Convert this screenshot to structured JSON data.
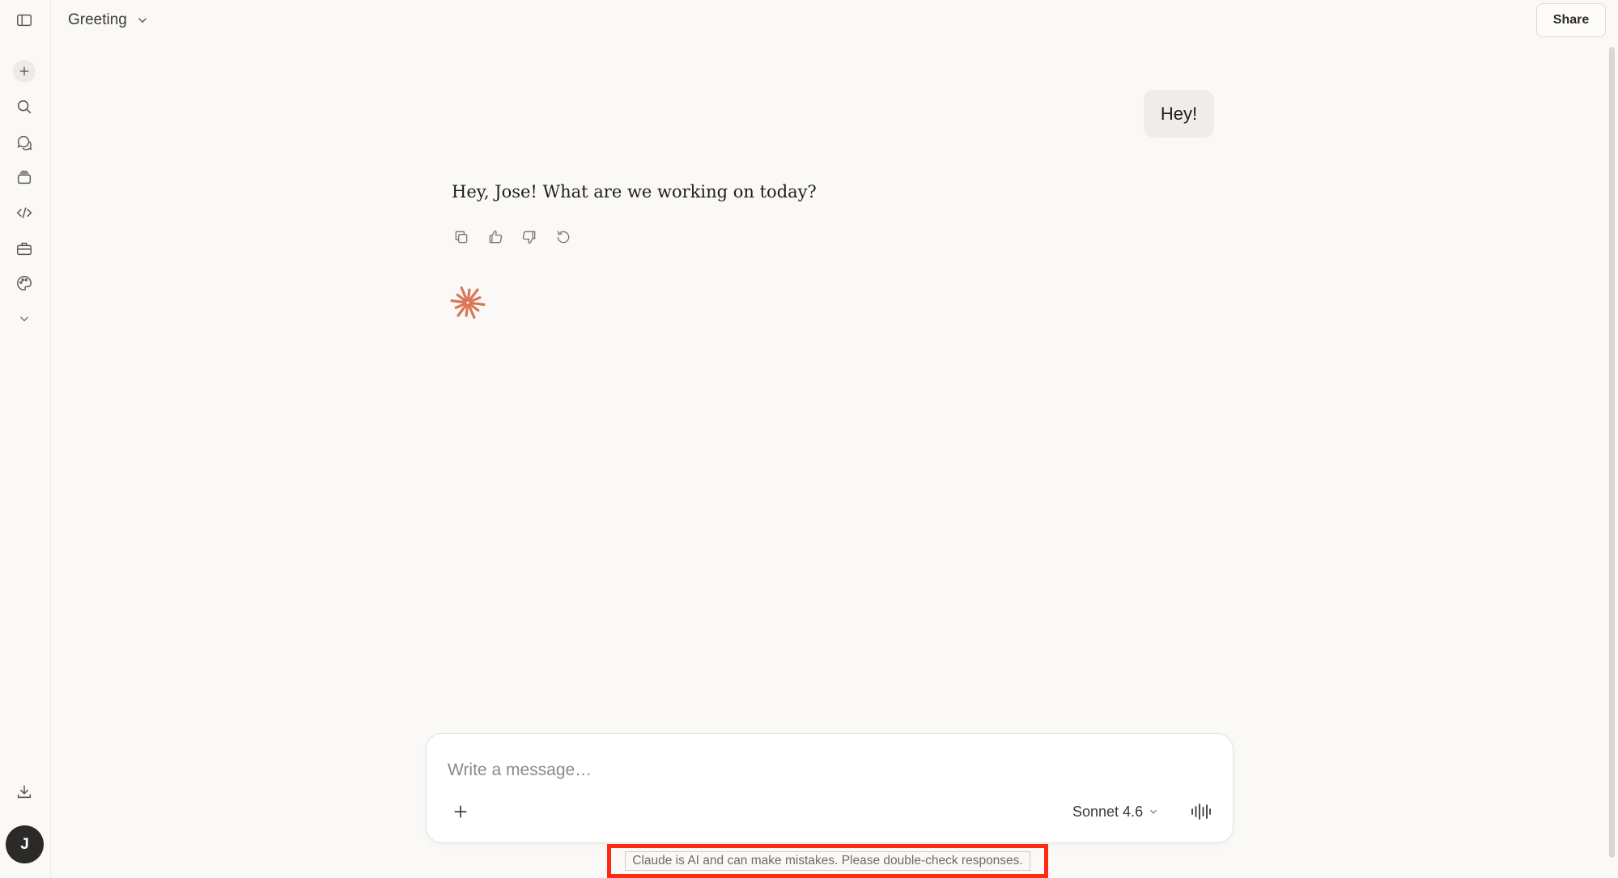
{
  "header": {
    "title": "Greeting",
    "share_label": "Share"
  },
  "sidebar": {
    "icons": [
      "sidebar-toggle-icon",
      "plus-icon",
      "search-icon",
      "chats-icon",
      "projects-icon",
      "code-icon",
      "toolbox-icon",
      "palette-icon",
      "chevron-down-icon",
      "download-icon"
    ],
    "avatar_initial": "J"
  },
  "conversation": {
    "user_message": "Hey!",
    "assistant_message": "Hey, Jose! What are we working on today?",
    "action_icons": [
      "copy-icon",
      "thumbs-up-icon",
      "thumbs-down-icon",
      "retry-icon"
    ]
  },
  "composer": {
    "placeholder": "Write a message…",
    "value": "",
    "model_label": "Sonnet 4.6"
  },
  "footer": {
    "disclaimer": "Claude is AI and can make mistakes. Please double-check responses."
  },
  "colors": {
    "background": "#faf9f7",
    "accent": "#d97757",
    "highlight": "#ff2a12"
  }
}
